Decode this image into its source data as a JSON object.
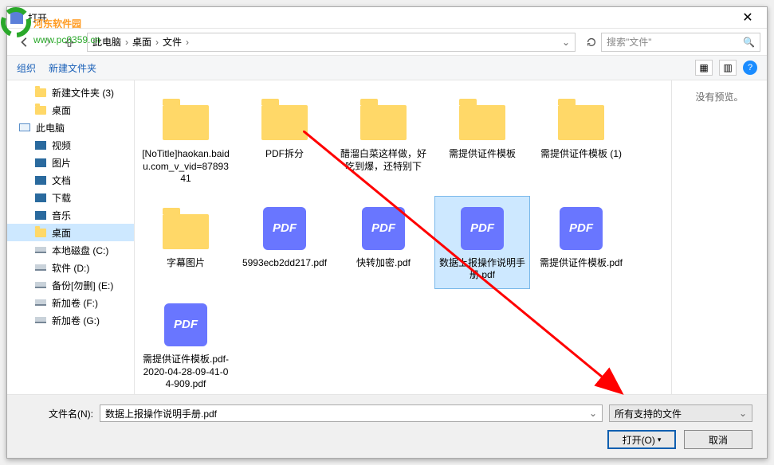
{
  "title": "打开",
  "watermark": {
    "line1": "河东软件园",
    "site": "www.pc0359.cn"
  },
  "breadcrumb": {
    "root": "此电脑",
    "p1": "桌面",
    "p2": "文件"
  },
  "search_placeholder": "搜索\"文件\"",
  "toolbar": {
    "org": "组织",
    "newfolder": "新建文件夹"
  },
  "sidebar": {
    "items": [
      {
        "label": "新建文件夹 (3)",
        "type": "folder",
        "lvl": 1
      },
      {
        "label": "桌面",
        "type": "folder",
        "lvl": 1
      },
      {
        "label": "此电脑",
        "type": "pc",
        "lvl": 0,
        "header": true
      },
      {
        "label": "视频",
        "type": "media",
        "lvl": 1
      },
      {
        "label": "图片",
        "type": "media",
        "lvl": 1
      },
      {
        "label": "文档",
        "type": "media",
        "lvl": 1
      },
      {
        "label": "下载",
        "type": "media",
        "lvl": 1
      },
      {
        "label": "音乐",
        "type": "media",
        "lvl": 1
      },
      {
        "label": "桌面",
        "type": "folder",
        "lvl": 1,
        "sel": true
      },
      {
        "label": "本地磁盘 (C:)",
        "type": "drive",
        "lvl": 1
      },
      {
        "label": "软件 (D:)",
        "type": "drive",
        "lvl": 1
      },
      {
        "label": "备份[勿删] (E:)",
        "type": "drive",
        "lvl": 1
      },
      {
        "label": "新加卷 (F:)",
        "type": "drive",
        "lvl": 1
      },
      {
        "label": "新加卷 (G:)",
        "type": "drive",
        "lvl": 1
      }
    ]
  },
  "files": [
    {
      "name": "[NoTitle]haokan.baidu.com_v_vid=8789341",
      "type": "folder"
    },
    {
      "name": "PDF拆分",
      "type": "folder"
    },
    {
      "name": "醋溜白菜这样做，好吃到爆，还特别下",
      "type": "folder"
    },
    {
      "name": "需提供证件模板",
      "type": "folder"
    },
    {
      "name": "需提供证件模板 (1)",
      "type": "folder"
    },
    {
      "name": "字幕图片",
      "type": "folder"
    },
    {
      "name": "5993ecb2dd217.pdf",
      "type": "pdf"
    },
    {
      "name": "快转加密.pdf",
      "type": "pdf"
    },
    {
      "name": "数据上报操作说明手册.pdf",
      "type": "pdf",
      "sel": true
    },
    {
      "name": "需提供证件模板.pdf",
      "type": "pdf"
    },
    {
      "name": "需提供证件模板.pdf-2020-04-28-09-41-04-909.pdf",
      "type": "pdf"
    }
  ],
  "preview_text": "没有预览。",
  "pdf_badge": "PDF",
  "footer": {
    "filename_label": "文件名(N):",
    "filename_value": "数据上报操作说明手册.pdf",
    "filter": "所有支持的文件",
    "open": "打开(O)",
    "cancel": "取消"
  }
}
